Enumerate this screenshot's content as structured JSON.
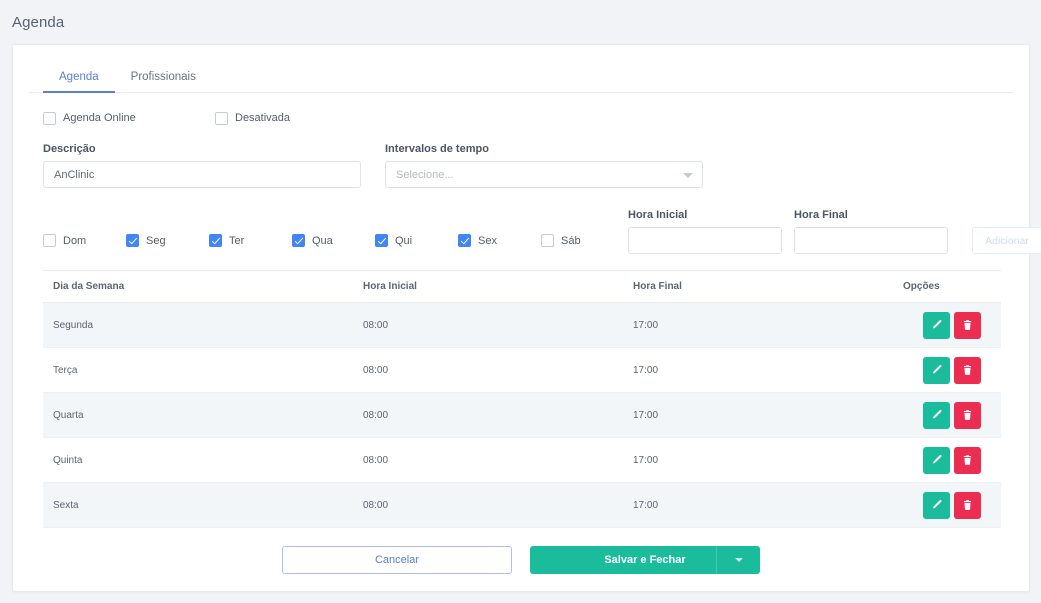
{
  "topbar": {
    "title": "Agenda"
  },
  "tabs": [
    {
      "label": "Agenda",
      "active": true
    },
    {
      "label": "Profissionais",
      "active": false
    }
  ],
  "options": [
    {
      "label": "Agenda Online",
      "checked": false
    },
    {
      "label": "Desativada",
      "checked": false
    }
  ],
  "fields": {
    "descricao": {
      "label": "Descrição",
      "value": "AnClinic",
      "placeholder": ""
    },
    "intervalos": {
      "label": "Intervalos de tempo",
      "value": "",
      "placeholder": "Selecione..."
    },
    "hora_inicial": {
      "label": "Hora Inicial",
      "value": "",
      "placeholder": ""
    },
    "hora_final": {
      "label": "Hora Final",
      "value": "",
      "placeholder": ""
    },
    "adicionar_label": "Adicionar"
  },
  "weekdays": [
    {
      "label": "Dom",
      "checked": false
    },
    {
      "label": "Seg",
      "checked": true
    },
    {
      "label": "Ter",
      "checked": true
    },
    {
      "label": "Qua",
      "checked": true
    },
    {
      "label": "Qui",
      "checked": true
    },
    {
      "label": "Sex",
      "checked": true
    },
    {
      "label": "Sáb",
      "checked": false
    }
  ],
  "table": {
    "columns": [
      "Dia da Semana",
      "Hora Inicial",
      "Hora Final",
      "Opções"
    ],
    "rows": [
      {
        "dia": "Segunda",
        "inicio": "08:00",
        "fim": "17:00"
      },
      {
        "dia": "Terça",
        "inicio": "08:00",
        "fim": "17:00"
      },
      {
        "dia": "Quarta",
        "inicio": "08:00",
        "fim": "17:00"
      },
      {
        "dia": "Quinta",
        "inicio": "08:00",
        "fim": "17:00"
      },
      {
        "dia": "Sexta",
        "inicio": "08:00",
        "fim": "17:00"
      }
    ],
    "action_icons": [
      "pencil-icon",
      "trash-icon"
    ]
  },
  "footer": {
    "cancel_label": "Cancelar",
    "save_label": "Salvar e Fechar",
    "save_caret_icon": "chevron-down-icon"
  },
  "colors": {
    "accent_blue": "#5b7fd4",
    "checkbox_blue": "#4285f4",
    "green": "#1abc9c",
    "red": "#ec2d52",
    "page_bg": "#f1f3f6",
    "row_stripe": "#f3f6f9"
  }
}
